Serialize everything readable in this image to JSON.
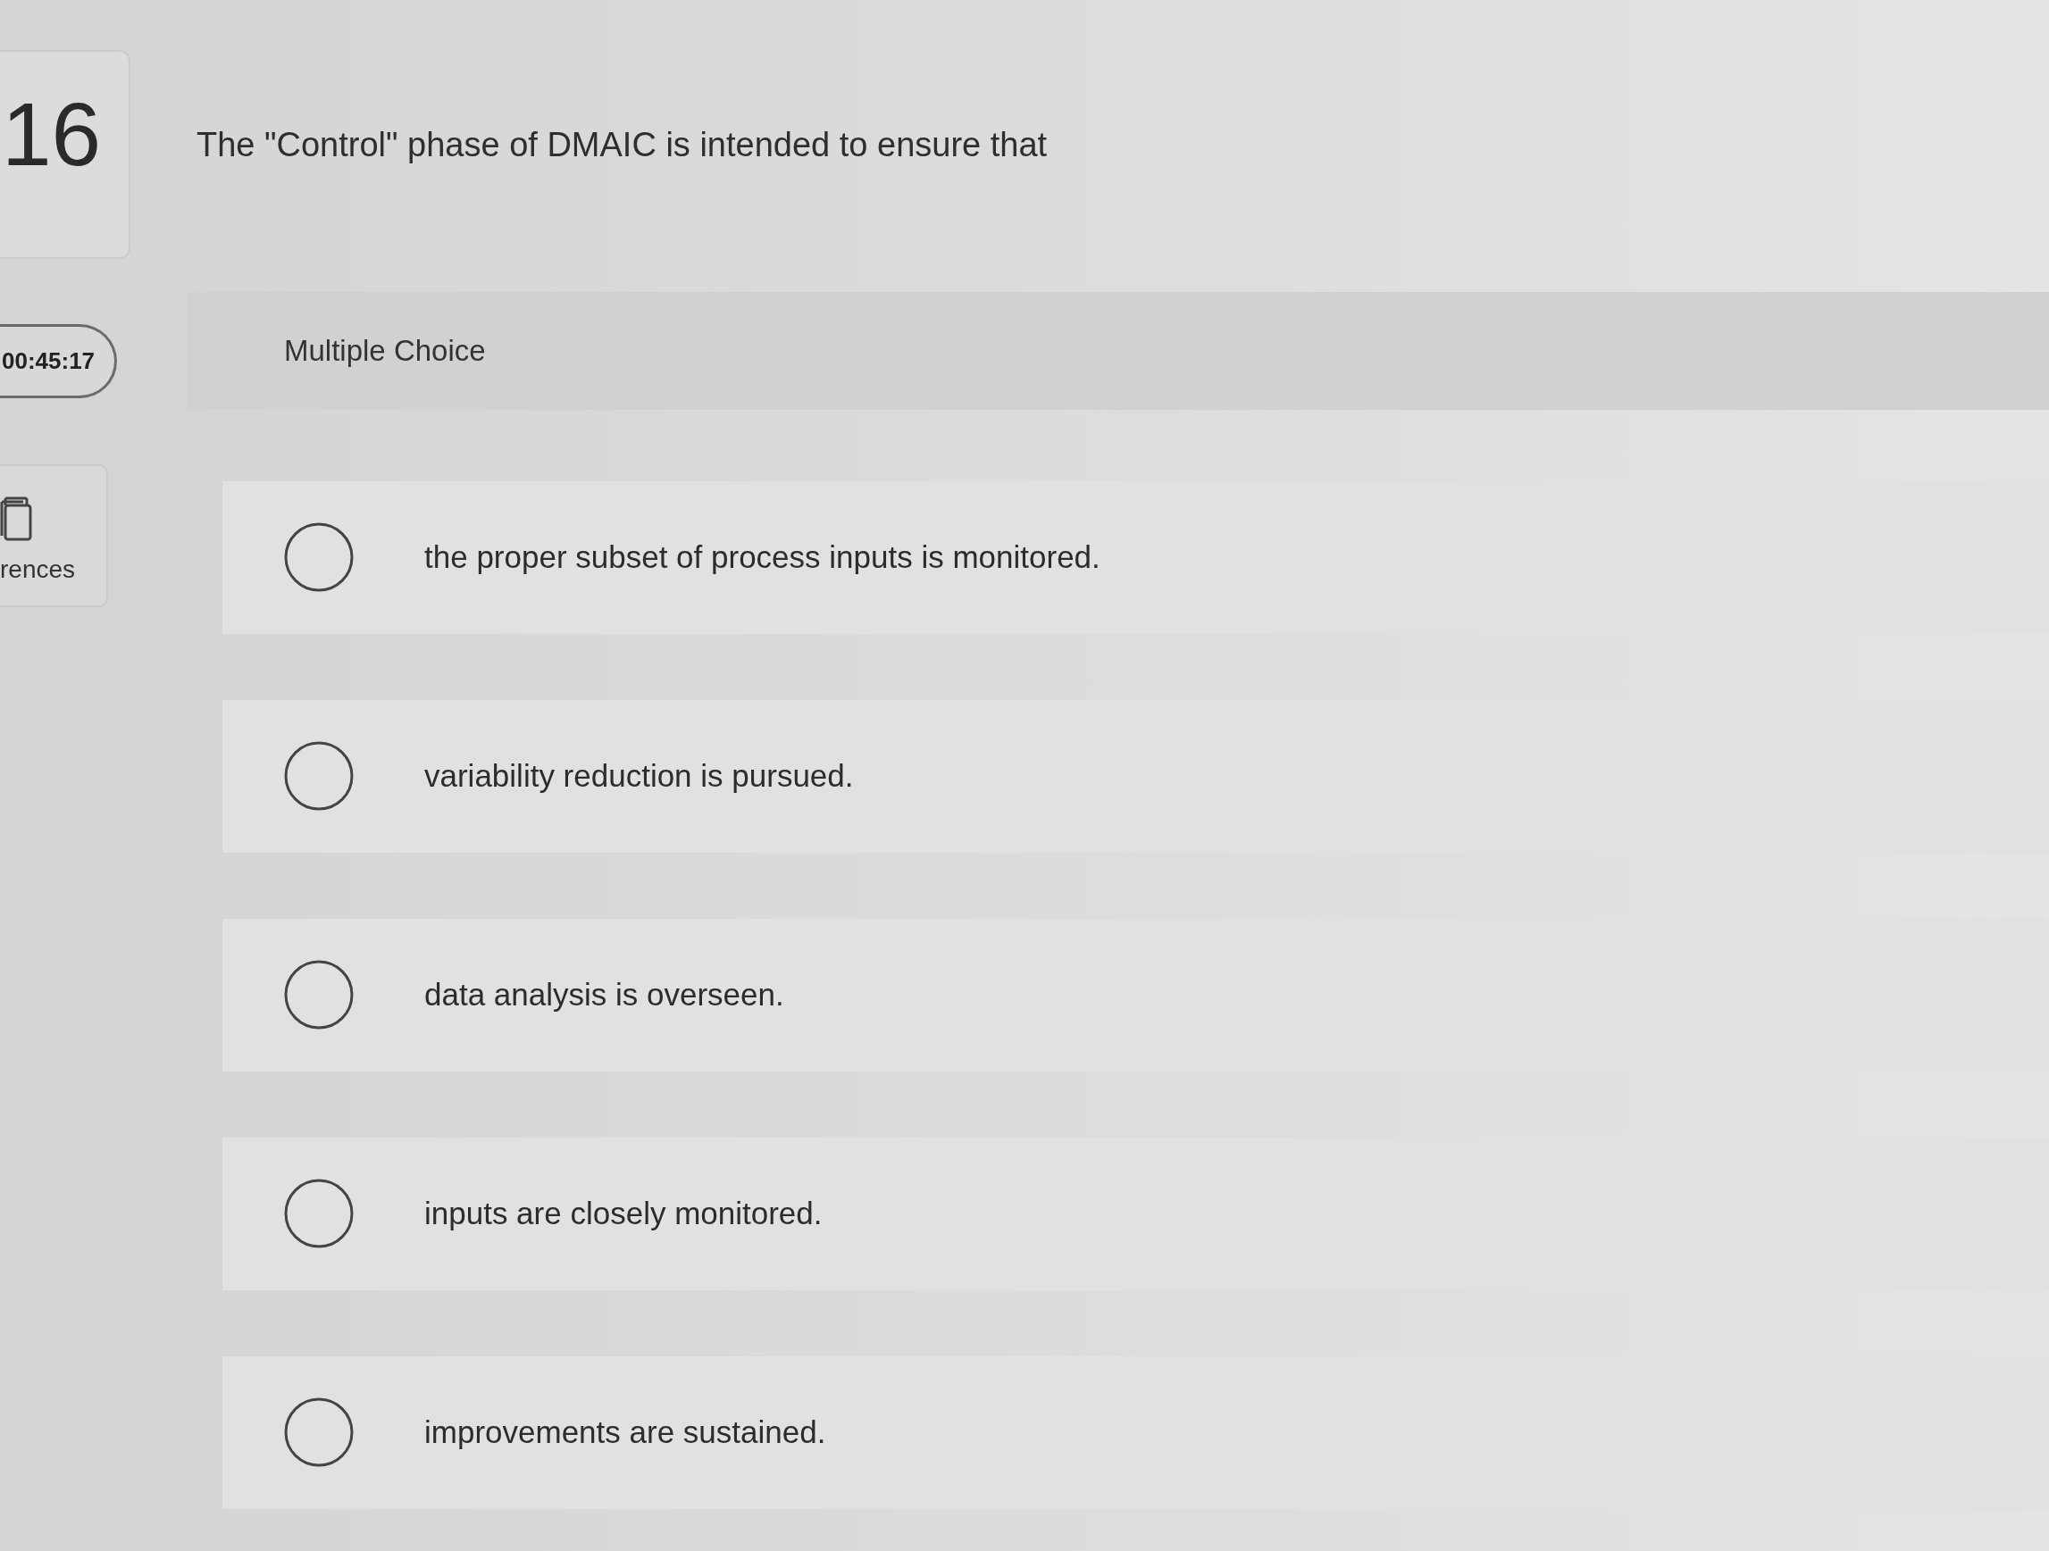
{
  "question": {
    "number": "16",
    "text": "The \"Control\" phase of DMAIC is intended to ensure that"
  },
  "timer": {
    "time": "00:45:17"
  },
  "references": {
    "label": "rences"
  },
  "answer": {
    "type_label": "Multiple Choice",
    "options": [
      {
        "text": "the proper subset of process inputs is monitored.",
        "selected": false
      },
      {
        "text": "variability reduction is pursued.",
        "selected": false
      },
      {
        "text": "data analysis is overseen.",
        "selected": false
      },
      {
        "text": "inputs are closely monitored.",
        "selected": false
      },
      {
        "text": "improvements are sustained.",
        "selected": false
      }
    ]
  }
}
